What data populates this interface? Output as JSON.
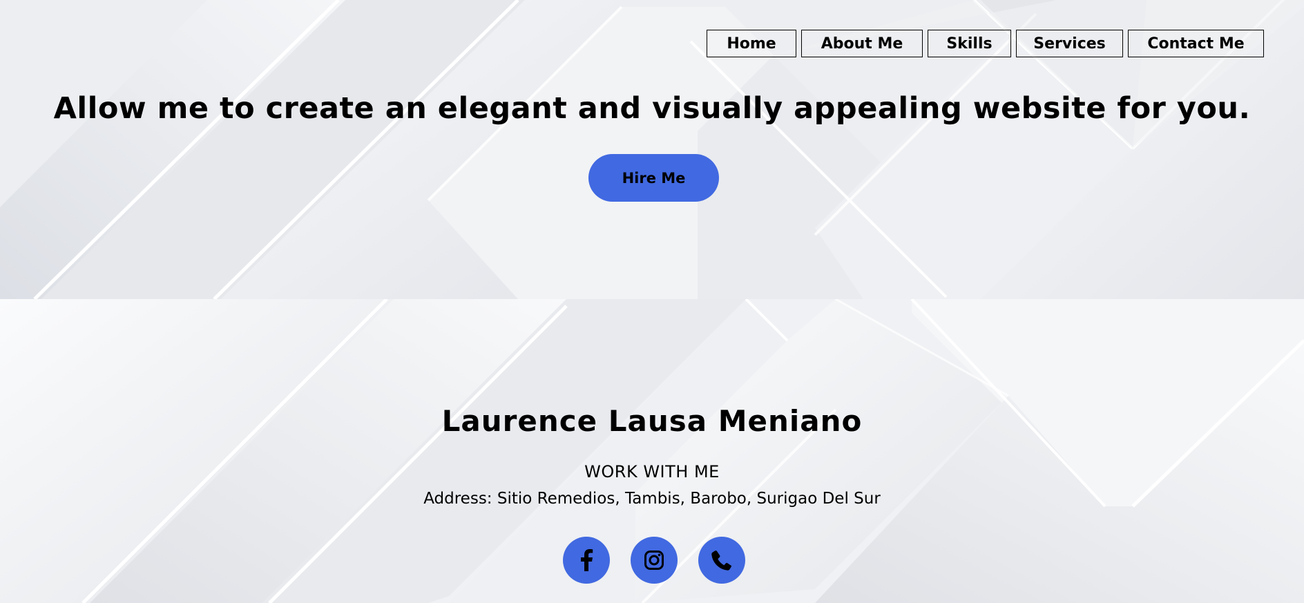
{
  "nav": {
    "items": [
      {
        "label": "Home"
      },
      {
        "label": "About Me"
      },
      {
        "label": "Skills"
      },
      {
        "label": "Services"
      },
      {
        "label": "Contact Me"
      }
    ]
  },
  "hero": {
    "headline": "Allow me to create an elegant and visually appealing website for you.",
    "cta_label": "Hire Me"
  },
  "footer": {
    "name": "Laurence Lausa Meniano",
    "tagline": "WORK WITH ME",
    "address": "Address: Sitio Remedios, Tambis, Barobo, Surigao Del Sur",
    "socials": [
      {
        "icon": "facebook-icon"
      },
      {
        "icon": "instagram-icon"
      },
      {
        "icon": "phone-icon"
      }
    ]
  },
  "colors": {
    "accent": "#4169e1",
    "background": "#eef0f3",
    "text": "#000000"
  }
}
